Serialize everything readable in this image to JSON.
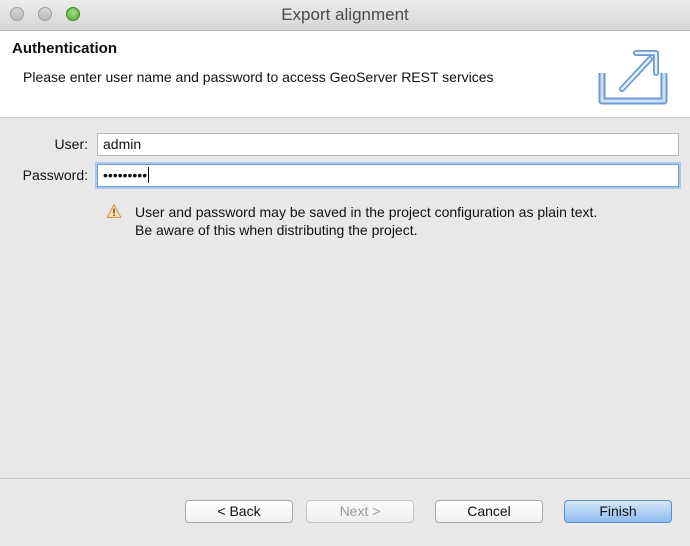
{
  "window": {
    "title": "Export alignment"
  },
  "header": {
    "title": "Authentication",
    "description": "Please enter user name and password to access GeoServer REST services",
    "icon": "export-icon"
  },
  "form": {
    "user_label": "User:",
    "user_value": "admin",
    "password_label": "Password:",
    "password_mask": "•••••••••"
  },
  "warning": {
    "icon": "warning-icon",
    "line1": "User and password may be saved in the project configuration as plain text.",
    "line2": "Be aware of this when distributing the project."
  },
  "buttons": {
    "back": "< Back",
    "next": "Next >",
    "cancel": "Cancel",
    "finish": "Finish"
  },
  "colors": {
    "accent": "#6d9fd6",
    "default_button": "#8fbcf0"
  }
}
